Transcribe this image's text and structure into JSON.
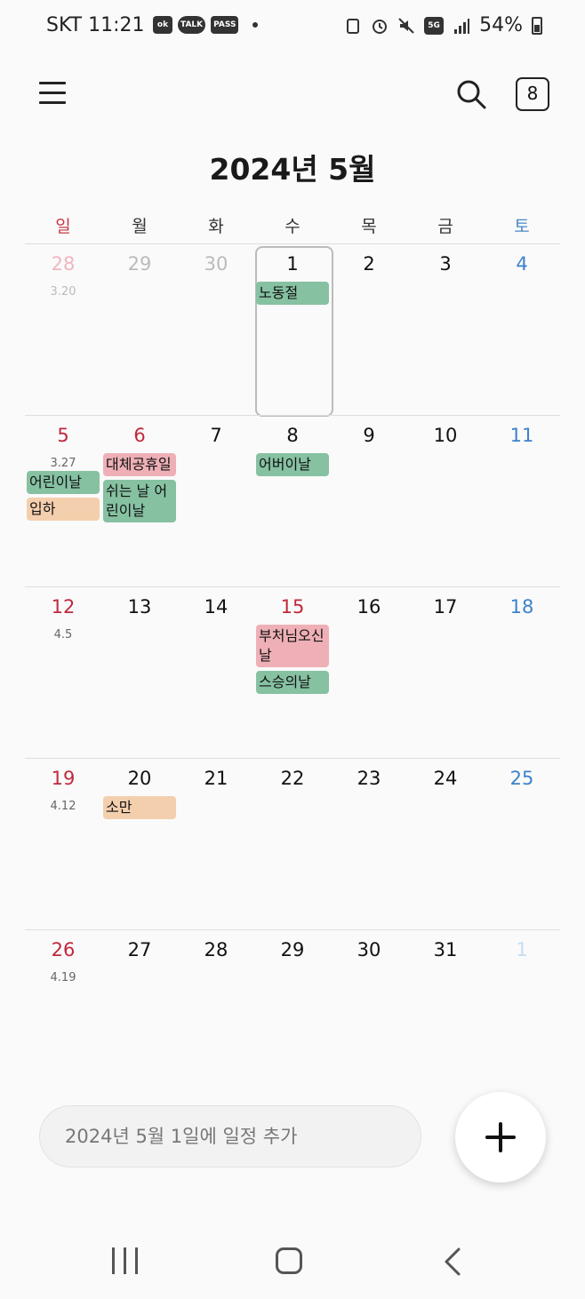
{
  "status_bar": {
    "carrier_time": "SKT 11:21",
    "notif_pass": "PASS",
    "notif_talk": "TALK",
    "notif_ok": "ok",
    "battery": "54%",
    "network": "5G"
  },
  "header": {
    "today_button": "8",
    "month_title": "2024년 5월"
  },
  "weekdays": [
    "일",
    "월",
    "화",
    "수",
    "목",
    "금",
    "토"
  ],
  "weeks": [
    [
      {
        "num": "28",
        "lunar": "3.20",
        "other": true,
        "kind": "sun"
      },
      {
        "num": "29",
        "other": true
      },
      {
        "num": "30",
        "other": true
      },
      {
        "num": "1",
        "selected": true,
        "events": [
          {
            "label": "노동절",
            "color": "green"
          }
        ]
      },
      {
        "num": "2"
      },
      {
        "num": "3"
      },
      {
        "num": "4",
        "kind": "sat"
      }
    ],
    [
      {
        "num": "5",
        "lunar": "3.27",
        "kind": "sun",
        "events": [
          {
            "label": "어린이날",
            "color": "green"
          },
          {
            "label": "입하",
            "color": "peach"
          }
        ]
      },
      {
        "num": "6",
        "kind": "sun",
        "events": [
          {
            "label": "대체공휴일",
            "color": "pink"
          },
          {
            "label": "쉬는 날 어린이날",
            "color": "green"
          }
        ]
      },
      {
        "num": "7"
      },
      {
        "num": "8",
        "events": [
          {
            "label": "어버이날",
            "color": "green"
          }
        ]
      },
      {
        "num": "9"
      },
      {
        "num": "10"
      },
      {
        "num": "11",
        "kind": "sat"
      }
    ],
    [
      {
        "num": "12",
        "lunar": "4.5",
        "kind": "sun"
      },
      {
        "num": "13"
      },
      {
        "num": "14"
      },
      {
        "num": "15",
        "kind": "sun",
        "events": [
          {
            "label": "부처님오신날",
            "color": "pink"
          },
          {
            "label": "스승의날",
            "color": "green"
          }
        ]
      },
      {
        "num": "16"
      },
      {
        "num": "17"
      },
      {
        "num": "18",
        "kind": "sat"
      }
    ],
    [
      {
        "num": "19",
        "lunar": "4.12",
        "kind": "sun"
      },
      {
        "num": "20",
        "events": [
          {
            "label": "소만",
            "color": "peach"
          }
        ]
      },
      {
        "num": "21"
      },
      {
        "num": "22"
      },
      {
        "num": "23"
      },
      {
        "num": "24"
      },
      {
        "num": "25",
        "kind": "sat"
      }
    ],
    [
      {
        "num": "26",
        "lunar": "4.19",
        "kind": "sun"
      },
      {
        "num": "27"
      },
      {
        "num": "28"
      },
      {
        "num": "29"
      },
      {
        "num": "30"
      },
      {
        "num": "31"
      },
      {
        "num": "1",
        "other": true,
        "kind": "sat"
      }
    ]
  ],
  "add_event": {
    "placeholder": "2024년 5월 1일에 일정 추가"
  },
  "colors": {
    "sunday": "#c0283c",
    "saturday": "#3d82cc",
    "event_green": "#86c1a2",
    "event_pink": "#eeb0b6",
    "event_peach": "#f4cfae"
  },
  "icons": [
    "menu-icon",
    "search-icon",
    "plus-icon",
    "recent-apps-icon",
    "home-icon",
    "back-icon"
  ]
}
